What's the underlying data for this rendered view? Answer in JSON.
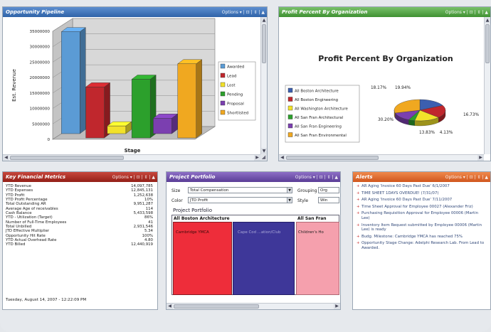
{
  "panels": {
    "opportunity": {
      "title": "Opportunity Pipeline",
      "options": "Options ▾ | ⊡ | ⇕ | ▲"
    },
    "profit": {
      "title": "Profit Percent By Organization",
      "options": "Options ▾ | ⊡ | ⇕ | ▲"
    },
    "metrics": {
      "title": "Key Financial Metrics",
      "options": "Options ▾ | ⊡ | ⇕ | ▲"
    },
    "portfolio": {
      "title": "Project Portfolio",
      "options": "Options ▾ | ⊡ | ⇕ | ▲"
    },
    "alerts": {
      "title": "Alerts",
      "options": "Options ▾ | ⊡ | ⇕ | ▲"
    }
  },
  "chart_data": [
    {
      "type": "bar",
      "title": "",
      "xlabel": "Stage",
      "ylabel": "Est. Revenue",
      "ylim": [
        0,
        35000000
      ],
      "yticks": [
        "35000000",
        "30000000",
        "25000000",
        "20000000",
        "15000000",
        "10000000",
        "5000000",
        "0"
      ],
      "series": [
        {
          "name": "Awarded",
          "color": "#5b9bd5",
          "value": 33000000
        },
        {
          "name": "Lead",
          "color": "#c0272d",
          "value": 16500000
        },
        {
          "name": "Lost",
          "color": "#f2e22a",
          "value": 2500000
        },
        {
          "name": "Pending",
          "color": "#2ca02c",
          "value": 19000000
        },
        {
          "name": "Proposal",
          "color": "#7b3fb0",
          "value": 5000000
        },
        {
          "name": "Shortlisted",
          "color": "#f0a820",
          "value": 24000000
        }
      ],
      "grid": true,
      "legend": "right"
    },
    {
      "type": "pie",
      "title": "Profit Percent By Organization",
      "slices": [
        {
          "name": "All Boston Architecture",
          "color": "#3c5fb0",
          "value": 18.17,
          "label": "18.17%"
        },
        {
          "name": "All Boston Engineering",
          "color": "#c0272d",
          "value": 19.94,
          "label": "19.94%"
        },
        {
          "name": "All Washington Architecture",
          "color": "#f2e22a",
          "value": 16.73,
          "label": "16.73%"
        },
        {
          "name": "All San Fran Architectural",
          "color": "#2ca02c",
          "value": 4.13,
          "label": "4.13%"
        },
        {
          "name": "All San Fran Engineering",
          "color": "#7b3fb0",
          "value": 13.83,
          "label": "13.83%"
        },
        {
          "name": "All San Fran Environmental",
          "color": "#f0a820",
          "value": 30.2,
          "label": "30.20%"
        }
      ],
      "legend": "left"
    }
  ],
  "metrics": {
    "rows": [
      {
        "label": "YTD Revenue",
        "value": "14,097,785"
      },
      {
        "label": "YTD Expenses",
        "value": "12,845,131"
      },
      {
        "label": "YTD Profit",
        "value": "1,252,638"
      },
      {
        "label": "YTD Profit Percentage",
        "value": "10%"
      },
      {
        "label": "Total Outstanding AR",
        "value": "9,951,287"
      },
      {
        "label": "Average Age of receivables",
        "value": "114"
      },
      {
        "label": "Cash Balance",
        "value": "5,433,598"
      },
      {
        "label": "YTD - Utilization (Target)",
        "value": "86%"
      },
      {
        "label": "Number of Full-Time Employees",
        "value": "41"
      },
      {
        "label": "Total Unbilled",
        "value": "2,931,546"
      },
      {
        "label": "JTD Effective Multiplier",
        "value": "5.34"
      },
      {
        "label": "Opportunity Hit Rate",
        "value": "100%"
      },
      {
        "label": "YTD Actual Overhead Rate",
        "value": "4.80"
      },
      {
        "label": "YTD Billed",
        "value": "12,440,919"
      }
    ],
    "timestamp": "Tuesday, August 14, 2007 - 12:22:09 PM"
  },
  "portfolio": {
    "size_label": "Size",
    "size_value": "Total Compensation",
    "color_label": "Color",
    "color_value": "JTD Profit",
    "grouping_label": "Grouping",
    "grouping_value": "Org",
    "style_label": "Style",
    "style_value": "Win",
    "section_title": "Project Portfolio",
    "col1_header": "All Boston Architecture",
    "col2_header": "All San Fran",
    "cell1": "Cambridge YMCA",
    "cell2": "Cape Cod ...ation/Club",
    "cell3": "Children's Ho"
  },
  "alerts": {
    "items": [
      "AR Aging 'Invoice 60 Days Past Due' 6/1/2007",
      "TIME SHEET 1DAYS OVERDUE! (7/31/07)",
      "AR Aging 'Invoice 60 Days Past Due' 7/11/2007",
      "Time Sheet Approval for Employee 00027 (Alexander Friz)",
      "Purchasing Requisition Approval for Employee 00006 (Martin Lee)",
      "Inventory Item Request submitted by Employee 00006 (Martin Lee) is ready",
      "Budg. Milestone: Cambridge YMCA has reached 75%",
      "Opportunity Stage Change: Adelphi Research Lab. From Lead to Awarded."
    ]
  }
}
